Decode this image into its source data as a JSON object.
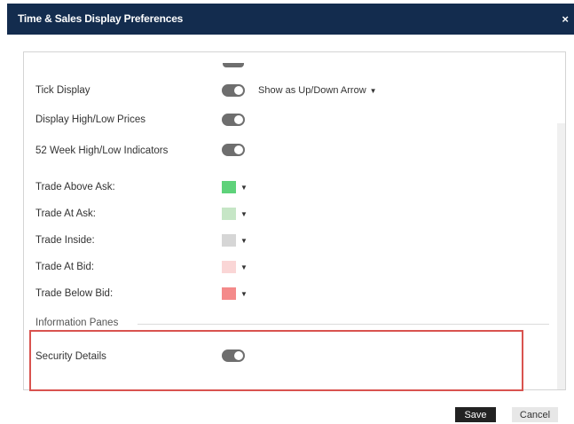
{
  "dialog": {
    "title": "Time & Sales Display Preferences",
    "close_glyph": "×"
  },
  "settings": {
    "tick_display": {
      "label": "Tick Display",
      "enabled": true,
      "dropdown_value": "Show as Up/Down Arrow"
    },
    "display_high_low": {
      "label": "Display High/Low Prices",
      "enabled": true
    },
    "week52_indicators": {
      "label": "52 Week High/Low Indicators",
      "enabled": true
    }
  },
  "trade_colors": [
    {
      "label": "Trade Above Ask:",
      "color": "#5ed27a"
    },
    {
      "label": "Trade At Ask:",
      "color": "#c6e6c6"
    },
    {
      "label": "Trade Inside:",
      "color": "#d6d6d6"
    },
    {
      "label": "Trade At Bid:",
      "color": "#fad6d6"
    },
    {
      "label": "Trade Below Bid:",
      "color": "#f48a8a"
    }
  ],
  "information_panes": {
    "header": "Information Panes",
    "security_details": {
      "label": "Security Details",
      "enabled": true
    }
  },
  "footer": {
    "save_label": "Save",
    "cancel_label": "Cancel"
  },
  "icons": {
    "close": "close-icon",
    "caret": "caret-down-icon"
  },
  "colors": {
    "titlebar": "#132c4e",
    "highlight": "#d9534f",
    "toggle": "#6e6e6e"
  }
}
